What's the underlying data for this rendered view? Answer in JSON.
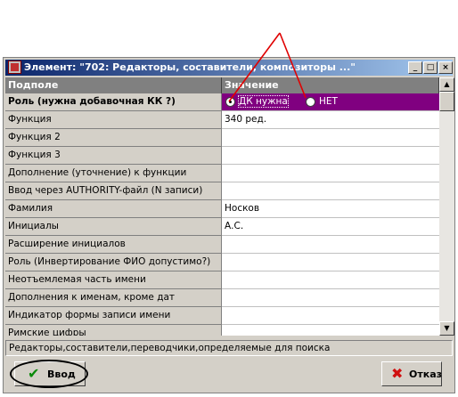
{
  "window": {
    "title": "Элемент: \"702: Редакторы, составители, композиторы ...\"",
    "minimize_glyph": "_",
    "maximize_glyph": "□",
    "close_glyph": "×",
    "icon": "app-icon"
  },
  "table": {
    "headers": [
      "Подполе",
      "Значение"
    ],
    "rows": [
      {
        "field": "Роль (нужна добавочная КК ?)",
        "value": ""
      },
      {
        "field": "Функция",
        "value": "340 ред."
      },
      {
        "field": "Функция 2",
        "value": ""
      },
      {
        "field": "Функция 3",
        "value": ""
      },
      {
        "field": "Дополнение (уточнение) к функции",
        "value": ""
      },
      {
        "field": "Ввод через AUTHORITY-файл (N записи)",
        "value": ""
      },
      {
        "field": "Фамилия",
        "value": "Носков"
      },
      {
        "field": "Инициалы",
        "value": "А.С."
      },
      {
        "field": "Расширение инициалов",
        "value": ""
      },
      {
        "field": "Роль (Инвертирование ФИО допустимо?)",
        "value": ""
      },
      {
        "field": "Неотъемлемая часть имени",
        "value": ""
      },
      {
        "field": "Дополнения к именам, кроме дат",
        "value": ""
      },
      {
        "field": "Индикатор формы записи имени",
        "value": ""
      },
      {
        "field": "Римские цифры",
        "value": ""
      }
    ],
    "selected_row": {
      "options": [
        {
          "label": "ДК нужна",
          "checked": true
        },
        {
          "label": "НЕТ",
          "checked": false
        }
      ],
      "highlight_color": "#800080"
    }
  },
  "status_text": "Редакторы,составители,переводчики,определяемые для поиска",
  "buttons": {
    "ok_label": "Ввод",
    "ok_icon": "checkmark-icon",
    "cancel_label": "Отказ",
    "cancel_icon": "x-icon"
  },
  "annotation_color": "#e00000"
}
